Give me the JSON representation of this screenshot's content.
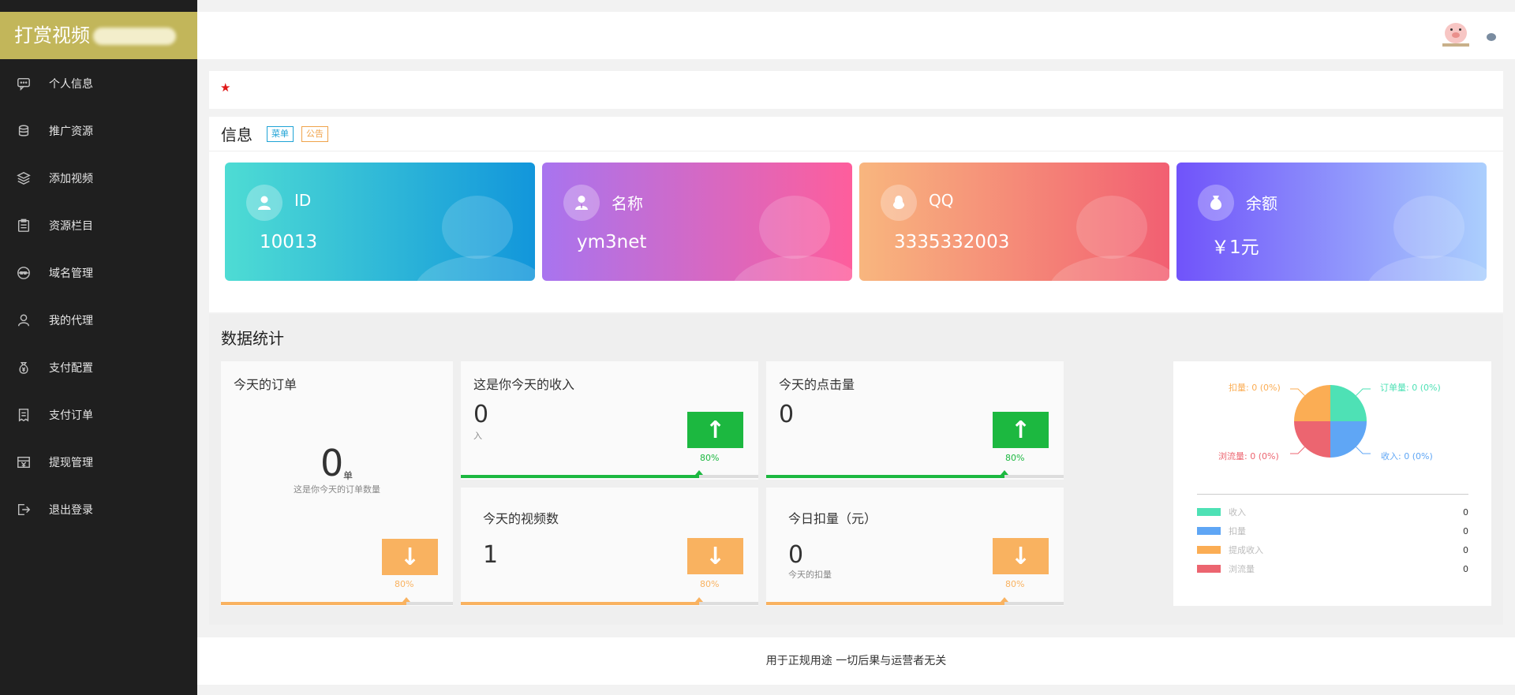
{
  "brand": {
    "title": "打赏视频"
  },
  "sidebar": {
    "items": [
      {
        "label": "个人信息",
        "icon": "chat-icon"
      },
      {
        "label": "推广资源",
        "icon": "stack-icon"
      },
      {
        "label": "添加视频",
        "icon": "layers-icon"
      },
      {
        "label": "资源栏目",
        "icon": "clipboard-icon"
      },
      {
        "label": "域名管理",
        "icon": "www-icon"
      },
      {
        "label": "我的代理",
        "icon": "user-icon"
      },
      {
        "label": "支付配置",
        "icon": "money-bag-icon"
      },
      {
        "label": "支付订单",
        "icon": "receipt-icon"
      },
      {
        "label": "提现管理",
        "icon": "withdraw-icon"
      },
      {
        "label": "退出登录",
        "icon": "logout-icon"
      }
    ]
  },
  "info": {
    "title": "信息",
    "tag_menu": "菜单",
    "tag_notice": "公告",
    "cards": [
      {
        "label": "ID",
        "value": "10013",
        "icon": "user-icon",
        "gradient": [
          "#4edcd4",
          "#1296db"
        ]
      },
      {
        "label": "名称",
        "value": "ym3net",
        "icon": "user-tie-icon",
        "gradient": [
          "#a874ef",
          "#fe5e9c"
        ]
      },
      {
        "label": "QQ",
        "value": "3335332003",
        "icon": "penguin-icon",
        "gradient": [
          "#f8b67e",
          "#f25f72"
        ]
      },
      {
        "label": "余额",
        "value": "￥1元",
        "icon": "money-bag-icon",
        "gradient": [
          "#7053fa",
          "#abcffd"
        ]
      }
    ]
  },
  "stats": {
    "title": "数据统计",
    "orders": {
      "title": "今天的订单",
      "value": "0",
      "unit": "单",
      "sub": "这是你今天的订单数量",
      "pct": "80%"
    },
    "income": {
      "title": "这是你今天的收入",
      "value": "0",
      "sub": "入",
      "pct": "80%"
    },
    "clicks": {
      "title": "今天的点击量",
      "value": "0",
      "pct": "80%"
    },
    "videos": {
      "title": "今天的视频数",
      "value": "1",
      "pct": "80%"
    },
    "deduct": {
      "title": "今日扣量（元）",
      "value": "0",
      "sub": "今天的扣量",
      "pct": "80%"
    },
    "progress_level": 0.8,
    "colors": {
      "up": "#1cb840",
      "down": "#f9b260"
    }
  },
  "chart_data": {
    "type": "pie",
    "slices": [
      {
        "label": "订单量: 0 (0%)",
        "value": 0,
        "color": "#4ee1b5"
      },
      {
        "label": "收入: 0 (0%)",
        "value": 0,
        "color": "#5fa6f5"
      },
      {
        "label": "浏流量: 0 (0%)",
        "value": 0,
        "color": "#ec6570"
      },
      {
        "label": "扣量: 0 (0%)",
        "value": 0,
        "color": "#fbad54"
      }
    ],
    "legend": [
      {
        "name": "收入",
        "value": "0",
        "color": "#4ee1b5"
      },
      {
        "name": "扣量",
        "value": "0",
        "color": "#5fa6f5"
      },
      {
        "name": "提成收入",
        "value": "0",
        "color": "#fbad54"
      },
      {
        "name": "浏流量",
        "value": "0",
        "color": "#ec6570"
      }
    ]
  },
  "footer": {
    "text": "用于正规用途 一切后果与运营者无关"
  }
}
